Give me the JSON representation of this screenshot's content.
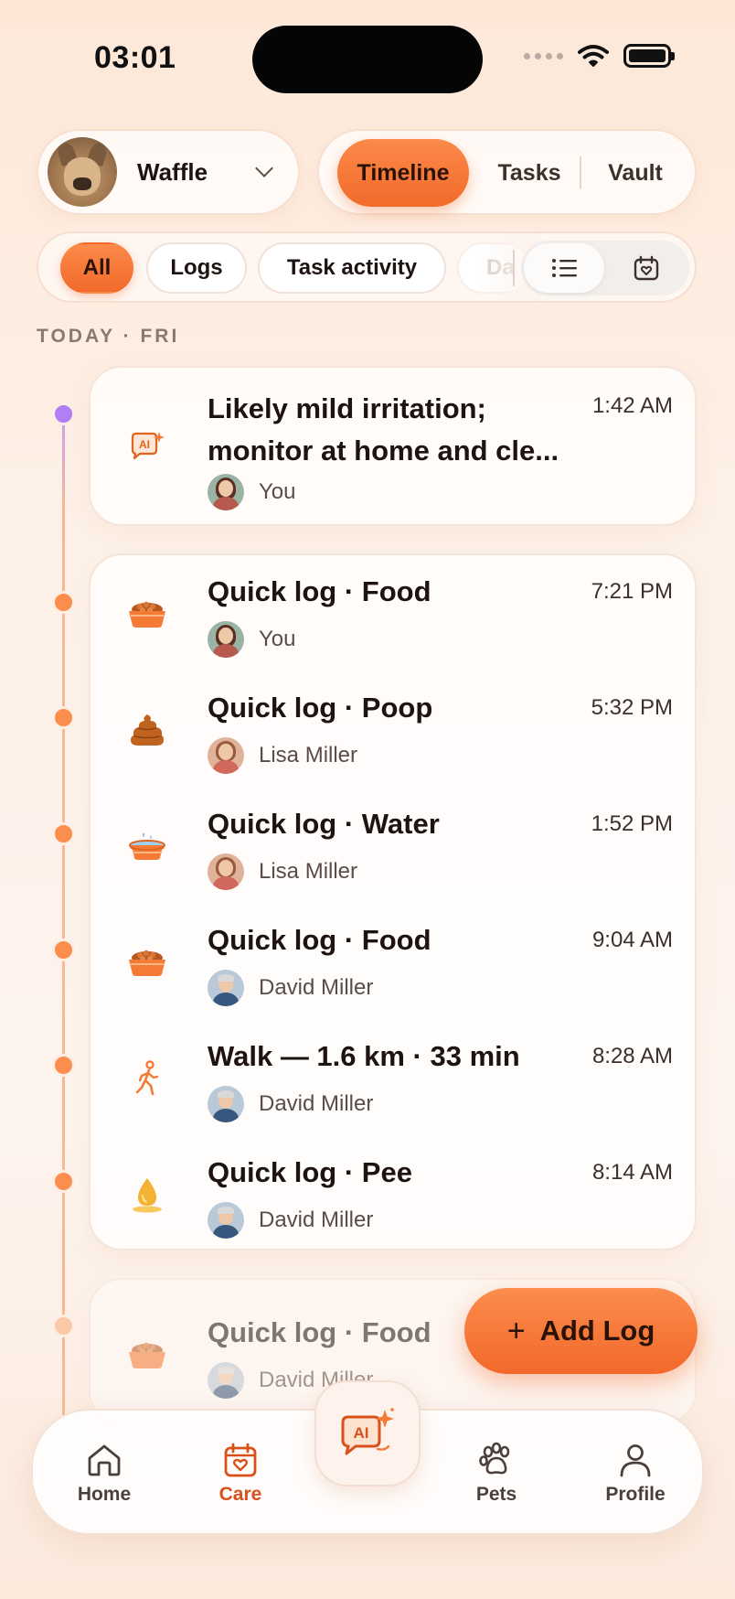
{
  "status_bar": {
    "time": "03:01"
  },
  "pet_selector": {
    "name": "Waffle"
  },
  "view_tabs": [
    {
      "label": "Timeline",
      "active": true
    },
    {
      "label": "Tasks",
      "active": false
    },
    {
      "label": "Vault",
      "active": false
    }
  ],
  "filters": {
    "chips": [
      {
        "label": "All",
        "active": true
      },
      {
        "label": "Logs",
        "active": false
      },
      {
        "label": "Task activity",
        "active": false
      },
      {
        "label": "Da",
        "active": false
      }
    ],
    "view_modes": {
      "active": "list"
    }
  },
  "section_label": "TODAY · FRI",
  "ai_entry": {
    "icon": "ai-chat-icon",
    "title": "Likely mild irritation; monitor at home and cle...",
    "time": "1:42 AM",
    "author": "You"
  },
  "log_entries": [
    {
      "icon": "food-bowl-icon",
      "title": "Quick log · Food",
      "time": "7:21 PM",
      "author": "You",
      "avatar": "you"
    },
    {
      "icon": "poop-icon",
      "title": "Quick log · Poop",
      "time": "5:32 PM",
      "author": "Lisa Miller",
      "avatar": "lisa"
    },
    {
      "icon": "water-bowl-icon",
      "title": "Quick log · Water",
      "time": "1:52 PM",
      "author": "Lisa Miller",
      "avatar": "lisa"
    },
    {
      "icon": "food-bowl-icon",
      "title": "Quick log · Food",
      "time": "9:04 AM",
      "author": "David Miller",
      "avatar": "david"
    },
    {
      "icon": "walk-icon",
      "title": "Walk — 1.6 km · 33 min",
      "time": "8:28 AM",
      "author": "David Miller",
      "avatar": "david"
    },
    {
      "icon": "pee-drop-icon",
      "title": "Quick log · Pee",
      "time": "8:14 AM",
      "author": "David Miller",
      "avatar": "david"
    }
  ],
  "partial_entry": {
    "icon": "food-bowl-icon",
    "title": "Quick log · Food",
    "author": "David Miller",
    "avatar": "david"
  },
  "add_log": {
    "plus": "+",
    "label": "Add Log"
  },
  "bottom_nav": {
    "home": "Home",
    "care": "Care",
    "ai": "AI",
    "pets": "Pets",
    "profile": "Profile",
    "active": "care"
  },
  "colors": {
    "accent": "#f26a2a",
    "accent_light": "#fb8a4a",
    "ai_dot": "#b07ef5",
    "active_nav": "#d8501a"
  }
}
